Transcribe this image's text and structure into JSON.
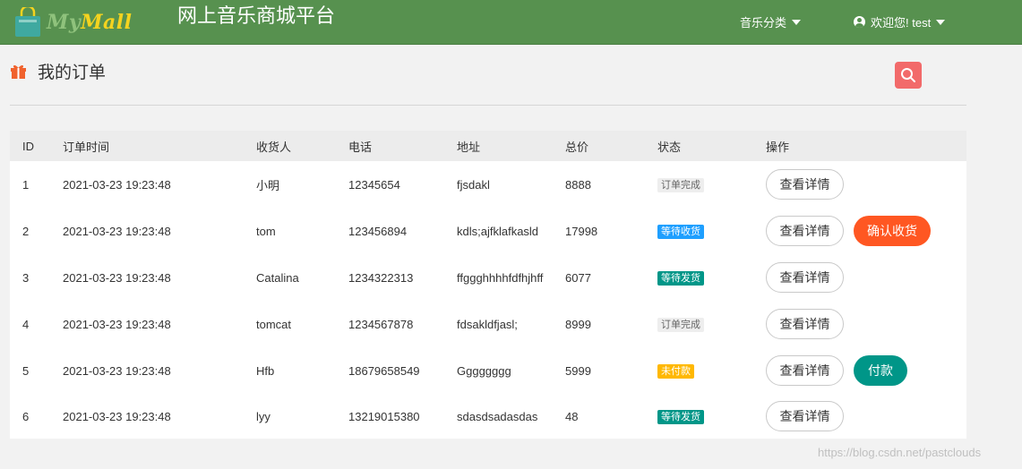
{
  "header": {
    "logo_text_dim": "My",
    "logo_text": "Mall",
    "site_title": "网上音乐商城平台",
    "nav_category": "音乐分类",
    "nav_user": "欢迎您! test"
  },
  "page": {
    "title": "我的订单"
  },
  "table": {
    "headers": [
      "ID",
      "订单时间",
      "收货人",
      "电话",
      "地址",
      "总价",
      "状态",
      "操作"
    ],
    "rows": [
      {
        "id": "1",
        "time": "2021-03-23 19:23:48",
        "name": "小明",
        "phone": "12345654",
        "address": "fjsdakl",
        "total": "8888",
        "status": "订单完成",
        "status_type": "done",
        "actions": [
          "查看详情"
        ]
      },
      {
        "id": "2",
        "time": "2021-03-23 19:23:48",
        "name": "tom",
        "phone": "123456894",
        "address": "kdls;ajfklafkasld",
        "total": "17998",
        "status": "等待收货",
        "status_type": "blue",
        "actions": [
          "查看详情",
          "确认收货"
        ]
      },
      {
        "id": "3",
        "time": "2021-03-23 19:23:48",
        "name": "Catalina",
        "phone": "1234322313",
        "address": "ffggghhhhfdfhjhff",
        "total": "6077",
        "status": "等待发货",
        "status_type": "green",
        "actions": [
          "查看详情"
        ]
      },
      {
        "id": "4",
        "time": "2021-03-23 19:23:48",
        "name": "tomcat",
        "phone": "1234567878",
        "address": "fdsakldfjasl;",
        "total": "8999",
        "status": "订单完成",
        "status_type": "done",
        "actions": [
          "查看详情"
        ]
      },
      {
        "id": "5",
        "time": "2021-03-23 19:23:48",
        "name": "Hfb",
        "phone": "18679658549",
        "address": "Gggggggg",
        "total": "5999",
        "status": "未付款",
        "status_type": "orange",
        "actions": [
          "查看详情",
          "付款"
        ]
      },
      {
        "id": "6",
        "time": "2021-03-23 19:23:48",
        "name": "lyy",
        "phone": "13219015380",
        "address": "sdasdsadasdas",
        "total": "48",
        "status": "等待发货",
        "status_type": "green",
        "actions": [
          "查看详情"
        ]
      }
    ]
  },
  "watermark": "https://blog.csdn.net/pastclouds",
  "colors": {
    "header_bg": "#57914f",
    "search_button": "#f26a6a",
    "confirm_button": "#ff5722",
    "pay_button": "#009688",
    "badge_blue": "#1e9fff",
    "badge_green": "#009688",
    "badge_orange": "#ffb800"
  },
  "icons": {
    "logo": "shopping-bag-icon",
    "category_caret": "caret-down-icon",
    "user": "user-circle-icon",
    "page": "gift-icon",
    "search": "search-icon"
  }
}
